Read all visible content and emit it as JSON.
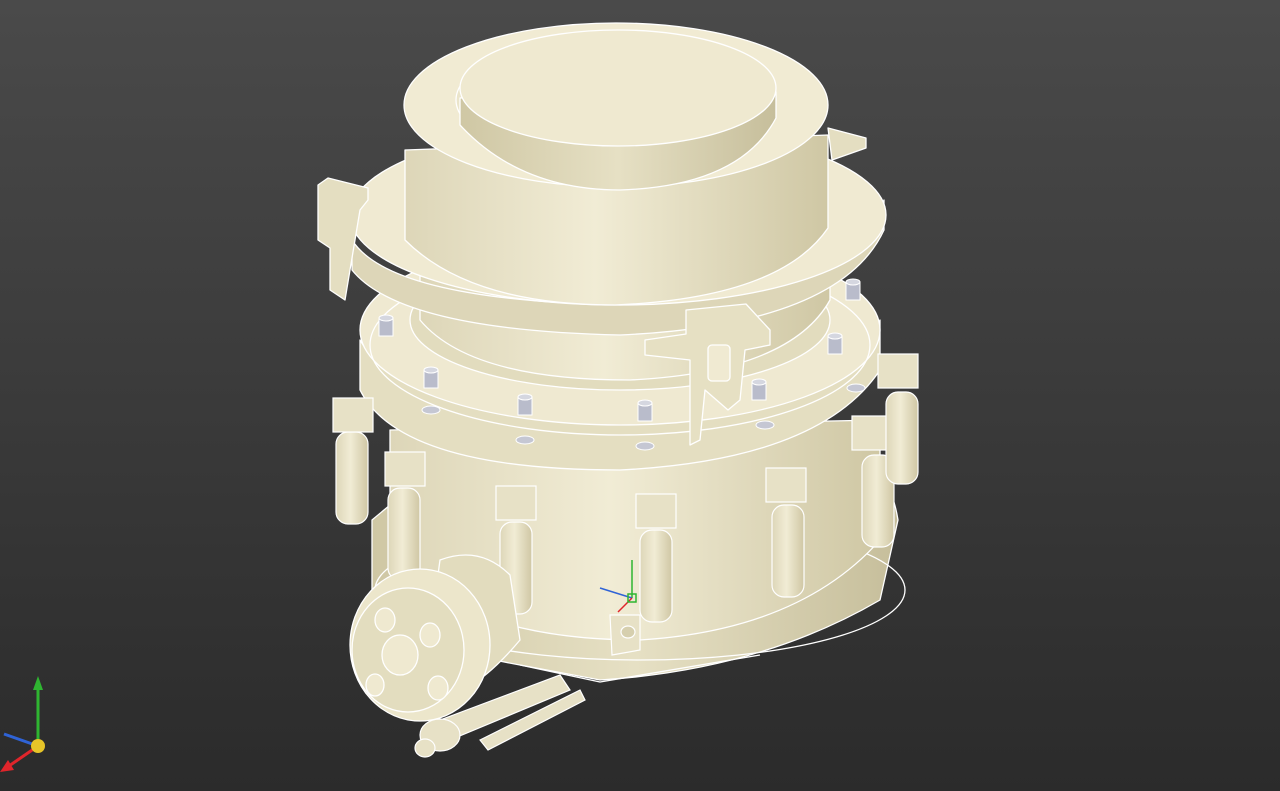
{
  "viewport": {
    "background_top": "#4a4a4a",
    "background_bottom": "#2b2b2b",
    "model_fill": "#ece6cb",
    "model_shade": "#d6cfae",
    "model_dark": "#bdb593",
    "edge_color": "#ffffff",
    "bolt_color": "#b9bccb"
  },
  "axis_triad": {
    "x_color": "#e0252b",
    "y_color": "#2fb531",
    "z_color": "#2f63d6",
    "origin_color": "#e6c428"
  },
  "model": {
    "name_icon": "cone-crusher-3d-model"
  }
}
